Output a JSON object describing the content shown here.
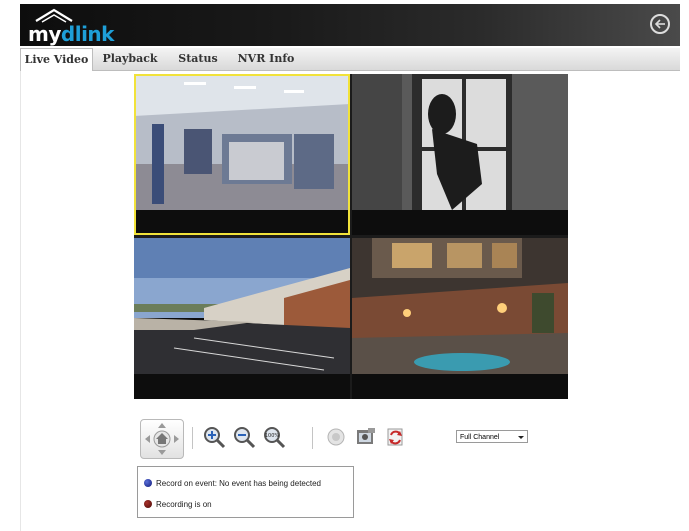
{
  "header": {
    "logo_my": "my",
    "logo_dlink": "dlink",
    "back_icon": "back-arrow-icon"
  },
  "tabs": [
    {
      "label": "Live Video",
      "active": true
    },
    {
      "label": "Playback",
      "active": false
    },
    {
      "label": "Status",
      "active": false
    },
    {
      "label": "NVR Info",
      "active": false
    }
  ],
  "cameras": [
    {
      "scene": "office interior",
      "selected": true
    },
    {
      "scene": "intruder at window",
      "selected": false
    },
    {
      "scene": "warehouse parking lot",
      "selected": false
    },
    {
      "scene": "backyard patio at night",
      "selected": false
    }
  ],
  "controls": {
    "ptz_icon": "ptz-home-icon",
    "zoom_in_icon": "zoom-in-icon",
    "zoom_out_icon": "zoom-out-icon",
    "zoom_original_icon": "zoom-100-icon",
    "zoom_original_label": "100%",
    "audio_icon": "audio-icon",
    "snapshot_icon": "snapshot-icon",
    "refresh_icon": "refresh-icon"
  },
  "channel_select": {
    "selected": "Full Channel"
  },
  "status": {
    "record_event": "Record on event: No event has being detected",
    "recording": "Recording is on"
  },
  "colors": {
    "accent": "#1e9fd8",
    "selected_border": "#f1e23a",
    "header_bg": "#1a1a1a"
  }
}
